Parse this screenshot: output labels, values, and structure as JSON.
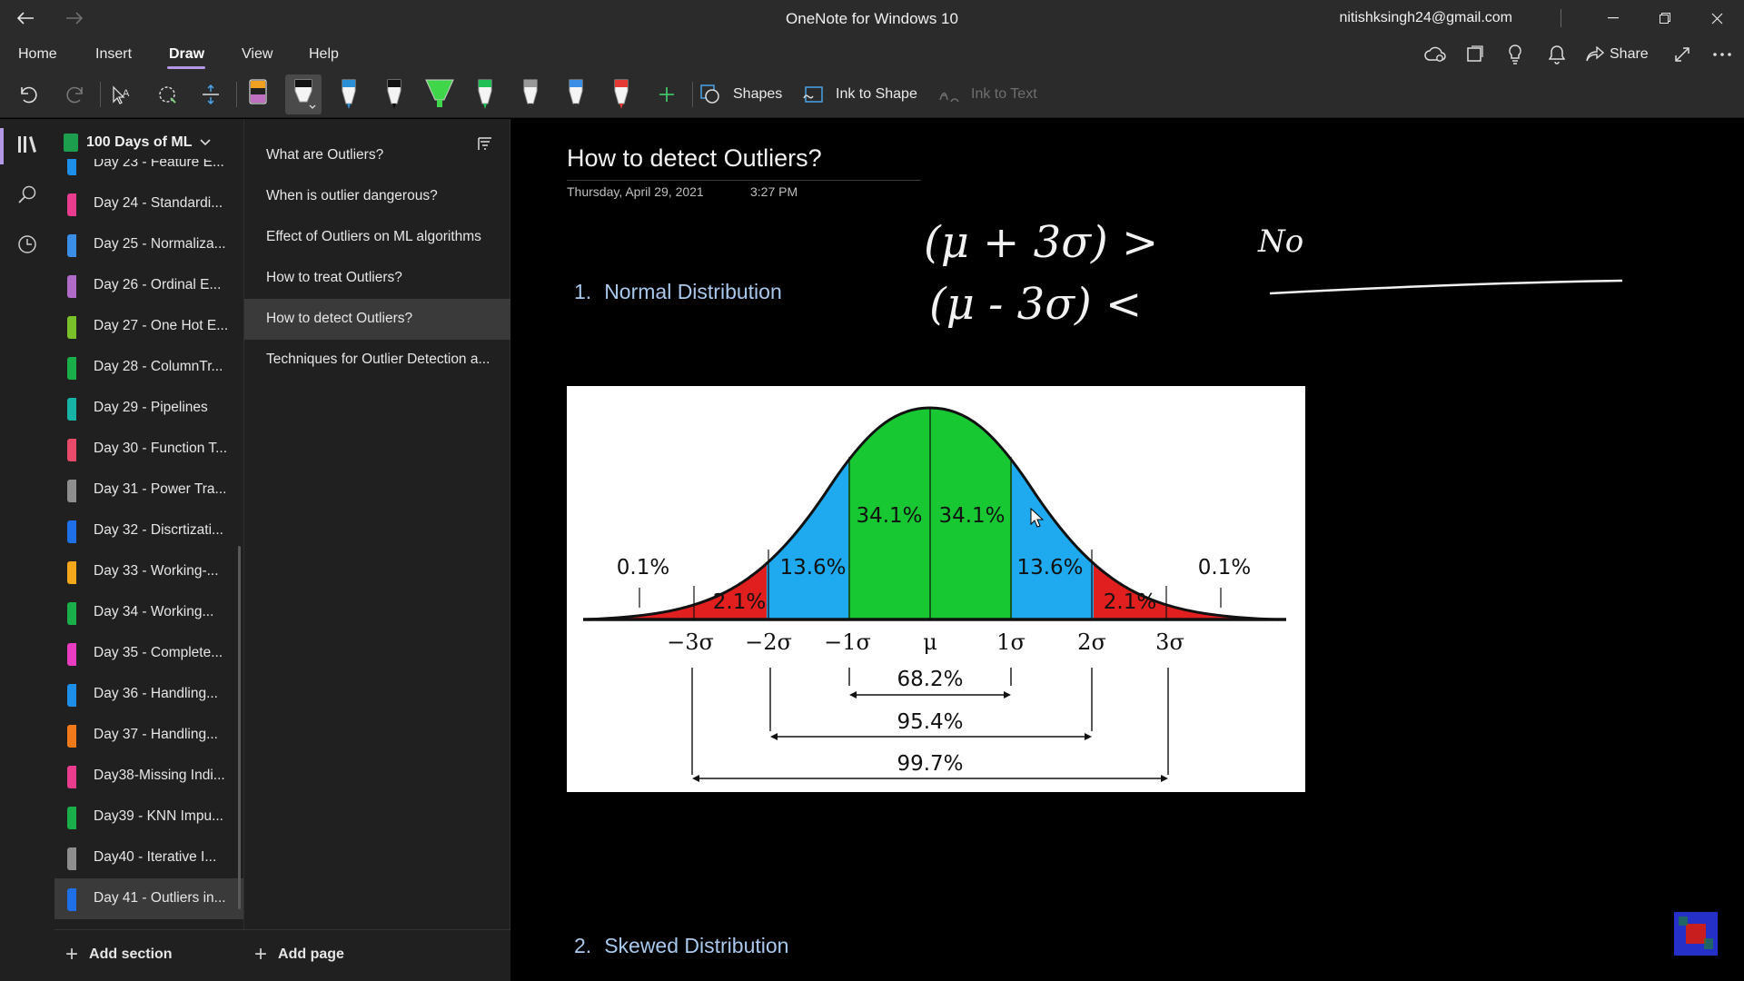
{
  "window": {
    "title": "OneNote for Windows 10",
    "account": "nitishksingh24@gmail.com",
    "controls": [
      "minimize",
      "restore",
      "close"
    ]
  },
  "ribbon": {
    "tabs": [
      "Home",
      "Insert",
      "Draw",
      "View",
      "Help"
    ],
    "active_tab": "Draw",
    "share_label": "Share"
  },
  "toolbar": {
    "shapes_label": "Shapes",
    "ink_to_shape_label": "Ink to Shape",
    "ink_to_text_label": "Ink to Text",
    "pens": [
      {
        "color": "#c070c0"
      },
      {
        "color": "#ffffff",
        "selected": true
      },
      {
        "color": "#2b8fd8"
      },
      {
        "color": "#e0e0e0"
      },
      {
        "color": "#3fd64a"
      },
      {
        "color": "#21c057"
      },
      {
        "color": "#b0b0b0"
      },
      {
        "color": "#3a8ee6"
      },
      {
        "color": "#e53935"
      }
    ]
  },
  "notebook": {
    "name": "100 Days of ML",
    "sections": [
      {
        "label": "Day 23 - Feature E...",
        "color": "#1e8fe8"
      },
      {
        "label": "Day 24 - Standardi...",
        "color": "#e93c8f"
      },
      {
        "label": "Day 25 - Normaliza...",
        "color": "#3a8ee6"
      },
      {
        "label": "Day 26 - Ordinal E...",
        "color": "#b06ac8"
      },
      {
        "label": "Day 27 - One Hot E...",
        "color": "#7ac02b"
      },
      {
        "label": "Day 28 - ColumnTr...",
        "color": "#1aae4a"
      },
      {
        "label": "Day 29 - Pipelines",
        "color": "#17b3a6"
      },
      {
        "label": "Day 30 - Function T...",
        "color": "#e84a6a"
      },
      {
        "label": "Day 31 - Power Tra...",
        "color": "#8e8e8e"
      },
      {
        "label": "Day 32 - Discrtizati...",
        "color": "#1e6fe8"
      },
      {
        "label": "Day 33 - Working-...",
        "color": "#f2a81a"
      },
      {
        "label": "Day 34 - Working...",
        "color": "#1aae4a"
      },
      {
        "label": "Day 35 - Complete...",
        "color": "#e93cc0"
      },
      {
        "label": "Day 36 - Handling...",
        "color": "#1e8fe8"
      },
      {
        "label": "Day 37 - Handling...",
        "color": "#f27a1a"
      },
      {
        "label": "Day38-Missing Indi...",
        "color": "#e93c8f"
      },
      {
        "label": "Day39 - KNN Impu...",
        "color": "#1aae4a"
      },
      {
        "label": "Day40 - Iterative I...",
        "color": "#8e8e8e"
      },
      {
        "label": "Day 41 - Outliers in...",
        "color": "#1e6fe8",
        "selected": true
      }
    ],
    "add_section_label": "Add section"
  },
  "pages": {
    "items": [
      {
        "label": "What are Outliers?"
      },
      {
        "label": "When is outlier dangerous?"
      },
      {
        "label": "Effect of Outliers on ML algorithms"
      },
      {
        "label": "How to treat Outliers?"
      },
      {
        "label": "How to detect Outliers?",
        "selected": true
      },
      {
        "label": "Techniques for Outlier Detection a..."
      }
    ],
    "add_page_label": "Add page"
  },
  "page": {
    "title": "How to detect Outliers?",
    "date": "Thursday, April 29, 2021",
    "time": "3:27 PM",
    "headings": [
      {
        "number": "1.",
        "text": "Normal Distribution"
      },
      {
        "number": "2.",
        "text": "Skewed Distribution"
      }
    ],
    "figure": {
      "region_percents": [
        "0.1%",
        "2.1%",
        "13.6%",
        "34.1%",
        "34.1%",
        "13.6%",
        "2.1%",
        "0.1%"
      ],
      "axis_ticks": [
        "−3σ",
        "−2σ",
        "−1σ",
        "μ",
        "1σ",
        "2σ",
        "3σ"
      ],
      "spans": [
        "68.2%",
        "95.4%",
        "99.7%"
      ],
      "colors": {
        "tail": "#e21f1f",
        "mid": "#1faaf0",
        "center": "#18c832"
      }
    },
    "handwriting": {
      "line1": "(μ + 3σ) >",
      "line2": "(μ - 3σ) <",
      "note": "No"
    }
  }
}
